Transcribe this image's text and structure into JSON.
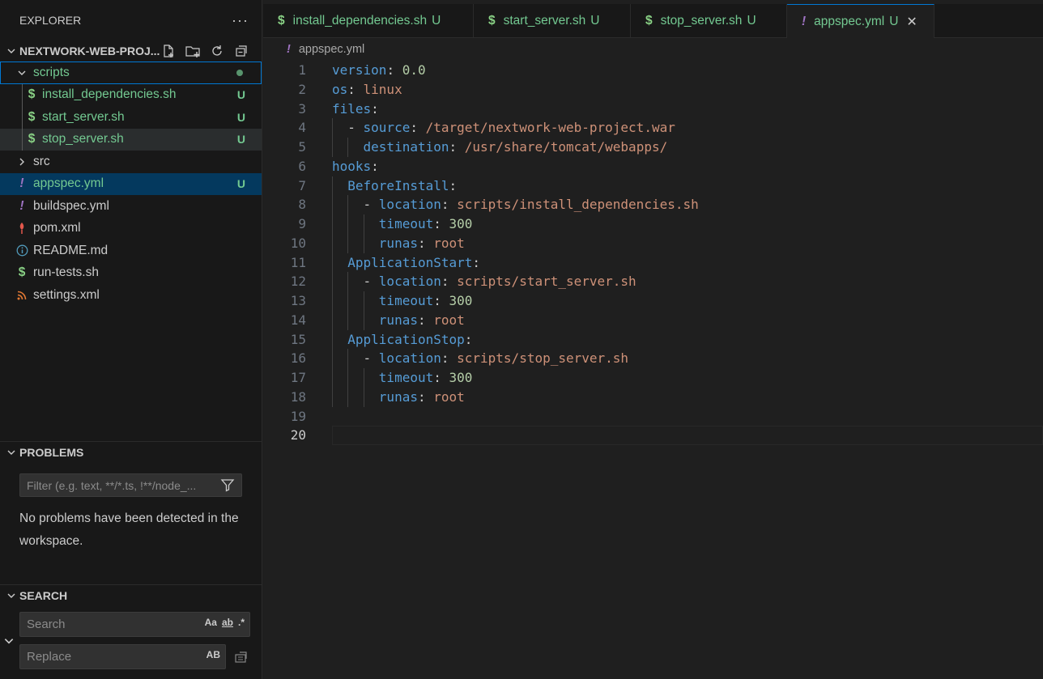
{
  "explorer": {
    "title": "EXPLORER",
    "project": "NEXTWORK-WEB-PROJ...",
    "scripts_folder": "scripts",
    "scripts": [
      {
        "name": "install_dependencies.sh",
        "badge": "U"
      },
      {
        "name": "start_server.sh",
        "badge": "U"
      },
      {
        "name": "stop_server.sh",
        "badge": "U"
      }
    ],
    "src_folder": "src",
    "files": [
      {
        "name": "appspec.yml",
        "badge": "U",
        "icon": "yaml-icon"
      },
      {
        "name": "buildspec.yml",
        "badge": "",
        "icon": "yaml-icon"
      },
      {
        "name": "pom.xml",
        "badge": "",
        "icon": "maven-icon"
      },
      {
        "name": "README.md",
        "badge": "",
        "icon": "info-icon"
      },
      {
        "name": "run-tests.sh",
        "badge": "",
        "icon": "shell-icon"
      },
      {
        "name": "settings.xml",
        "badge": "",
        "icon": "rss-icon"
      }
    ]
  },
  "problems": {
    "title": "PROBLEMS",
    "filter_placeholder": "Filter (e.g. text, **/*.ts, !**/node_...",
    "message": "No problems have been detected in the workspace."
  },
  "search": {
    "title": "SEARCH",
    "search_placeholder": "Search",
    "replace_placeholder": "Replace",
    "opt_case": "Aa",
    "opt_word": "ab",
    "opt_regex": ".*",
    "opt_replace_all": "AB"
  },
  "tabs": [
    {
      "label": "install_dependencies.sh",
      "icon": "$",
      "status": "U"
    },
    {
      "label": "start_server.sh",
      "icon": "$",
      "status": "U"
    },
    {
      "label": "stop_server.sh",
      "icon": "$",
      "status": "U"
    },
    {
      "label": "appspec.yml",
      "icon": "!",
      "status": "U"
    }
  ],
  "breadcrumb": {
    "icon": "!",
    "file": "appspec.yml"
  },
  "code_lines": [
    {
      "n": "1",
      "indent": 0
    },
    {
      "n": "2",
      "indent": 0
    },
    {
      "n": "3",
      "indent": 0
    },
    {
      "n": "4",
      "indent": 1
    },
    {
      "n": "5",
      "indent": 2
    },
    {
      "n": "6",
      "indent": 0
    },
    {
      "n": "7",
      "indent": 1
    },
    {
      "n": "8",
      "indent": 2
    },
    {
      "n": "9",
      "indent": 3
    },
    {
      "n": "10",
      "indent": 3
    },
    {
      "n": "11",
      "indent": 1
    },
    {
      "n": "12",
      "indent": 2
    },
    {
      "n": "13",
      "indent": 3
    },
    {
      "n": "14",
      "indent": 3
    },
    {
      "n": "15",
      "indent": 1
    },
    {
      "n": "16",
      "indent": 2
    },
    {
      "n": "17",
      "indent": 3
    },
    {
      "n": "18",
      "indent": 3
    },
    {
      "n": "19",
      "indent": 0
    },
    {
      "n": "20",
      "indent": 0
    }
  ],
  "code": {
    "l1": [
      "version",
      ": ",
      "0.0"
    ],
    "l2": [
      "os",
      ": ",
      "linux"
    ],
    "l3": [
      "files",
      ":"
    ],
    "l4": [
      "  - ",
      "source",
      ": ",
      "/target/nextwork-web-project.war"
    ],
    "l5": [
      "    ",
      "destination",
      ": ",
      "/usr/share/tomcat/webapps/"
    ],
    "l6": [
      "hooks",
      ":"
    ],
    "l7": [
      "  ",
      "BeforeInstall",
      ":"
    ],
    "l8": [
      "    - ",
      "location",
      ": ",
      "scripts/install_dependencies.sh"
    ],
    "l9": [
      "      ",
      "timeout",
      ": ",
      "300"
    ],
    "l10": [
      "      ",
      "runas",
      ": ",
      "root"
    ],
    "l11": [
      "  ",
      "ApplicationStart",
      ":"
    ],
    "l12": [
      "    - ",
      "location",
      ": ",
      "scripts/start_server.sh"
    ],
    "l13": [
      "      ",
      "timeout",
      ": ",
      "300"
    ],
    "l14": [
      "      ",
      "runas",
      ": ",
      "root"
    ],
    "l15": [
      "  ",
      "ApplicationStop",
      ":"
    ],
    "l16": [
      "    - ",
      "location",
      ": ",
      "scripts/stop_server.sh"
    ],
    "l17": [
      "      ",
      "timeout",
      ": ",
      "300"
    ],
    "l18": [
      "      ",
      "runas",
      ": ",
      "root"
    ]
  },
  "colors": {
    "accent": "#0078d4",
    "untracked": "#73c991",
    "yaml_icon": "#a074c4",
    "shell_icon": "#89d185"
  }
}
